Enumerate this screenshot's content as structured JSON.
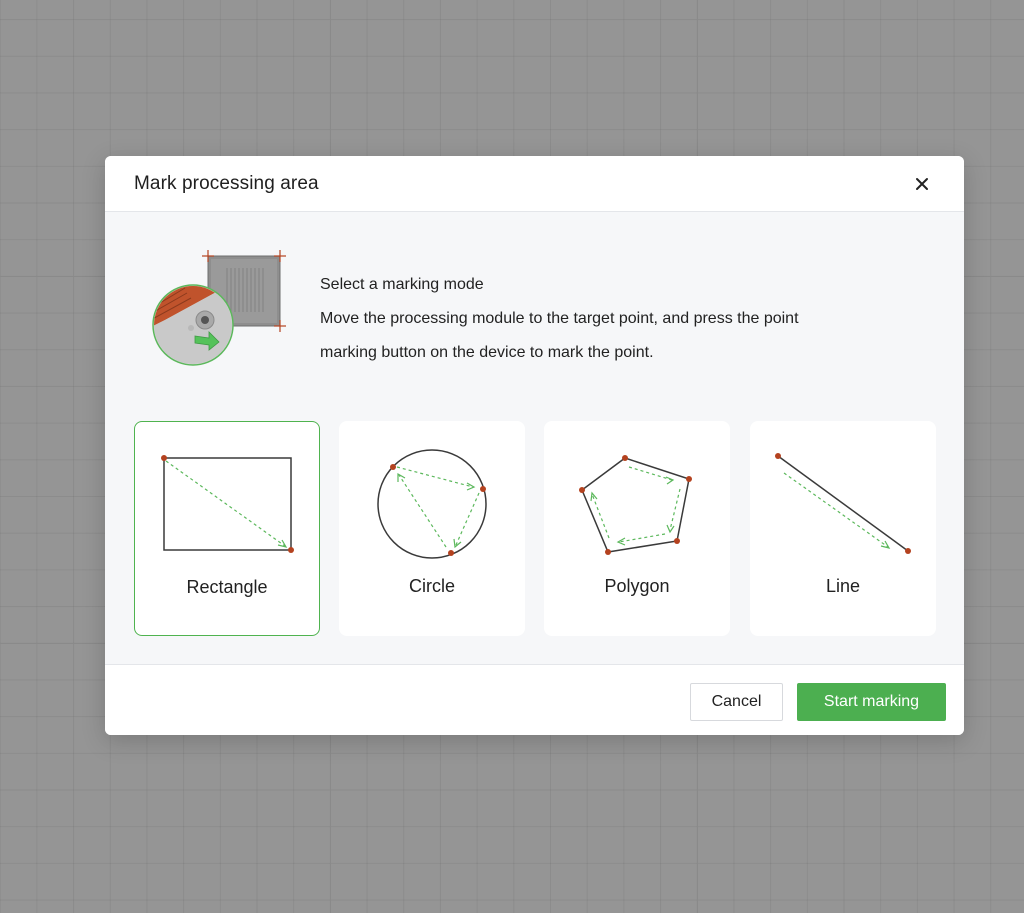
{
  "dialog": {
    "title": "Mark processing area",
    "close_icon": "close-icon"
  },
  "instructions": {
    "heading": "Select a marking mode",
    "line1": "Move the processing module to the target point, and press the point",
    "line2": "marking button on the device to mark the point."
  },
  "modes": [
    {
      "label": "Rectangle",
      "icon": "rectangle-mode-icon",
      "selected": true
    },
    {
      "label": "Circle",
      "icon": "circle-mode-icon",
      "selected": false
    },
    {
      "label": "Polygon",
      "icon": "polygon-mode-icon",
      "selected": false
    },
    {
      "label": "Line",
      "icon": "line-mode-icon",
      "selected": false
    }
  ],
  "footer": {
    "cancel_label": "Cancel",
    "start_label": "Start marking"
  },
  "colors": {
    "accent": "#4caf50",
    "point": "#b4421f",
    "guide": "#5cb85c"
  }
}
